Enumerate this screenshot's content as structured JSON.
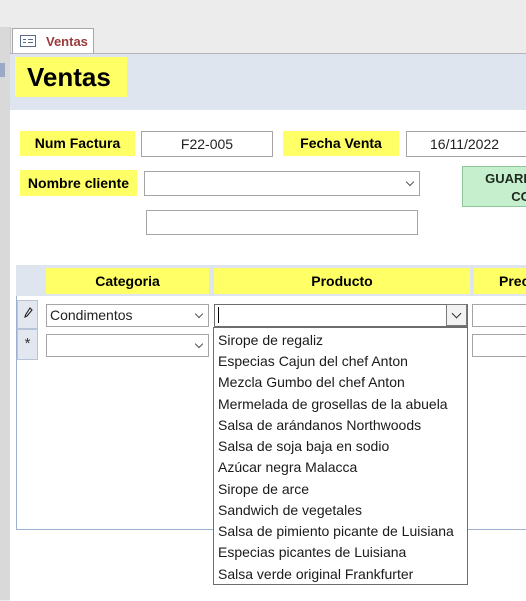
{
  "tab": {
    "label": "Ventas"
  },
  "form": {
    "title": "Ventas",
    "num_factura_label": "Num Factura",
    "num_factura_value": "F22-005",
    "fecha_venta_label": "Fecha Venta",
    "fecha_venta_value": "16/11/2022",
    "nombre_cliente_label": "Nombre cliente",
    "nombre_cliente_value": "",
    "extra_field_value": "",
    "guardar_button_label_line1": "GUARD",
    "guardar_button_label_line2": "CO"
  },
  "subform": {
    "columns": [
      "Categoria",
      "Producto",
      "Prec"
    ],
    "rows": [
      {
        "selector_icon": "pencil-icon",
        "categoria": "Condimentos",
        "producto": ""
      },
      {
        "selector_icon": "new-record-icon",
        "selector_glyph": "*",
        "categoria": "",
        "producto": ""
      }
    ],
    "producto_options": [
      "Sirope de regaliz",
      "Especias Cajun del chef Anton",
      "Mezcla Gumbo del chef Anton",
      "Mermelada de grosellas de la abuela",
      "Salsa de arándanos Northwoods",
      "Salsa de soja baja en sodio",
      "Azúcar negra Malacca",
      "Sirope de arce",
      "Sandwich de vegetales",
      "Salsa de pimiento picante de Luisiana",
      "Especias picantes de Luisiana",
      "Salsa verde original Frankfurter"
    ]
  },
  "colors": {
    "label_yellow": "#ffff66",
    "header_band": "#dee5ef",
    "green_button": "#c6efce",
    "tab_text": "#9b3a3a"
  }
}
